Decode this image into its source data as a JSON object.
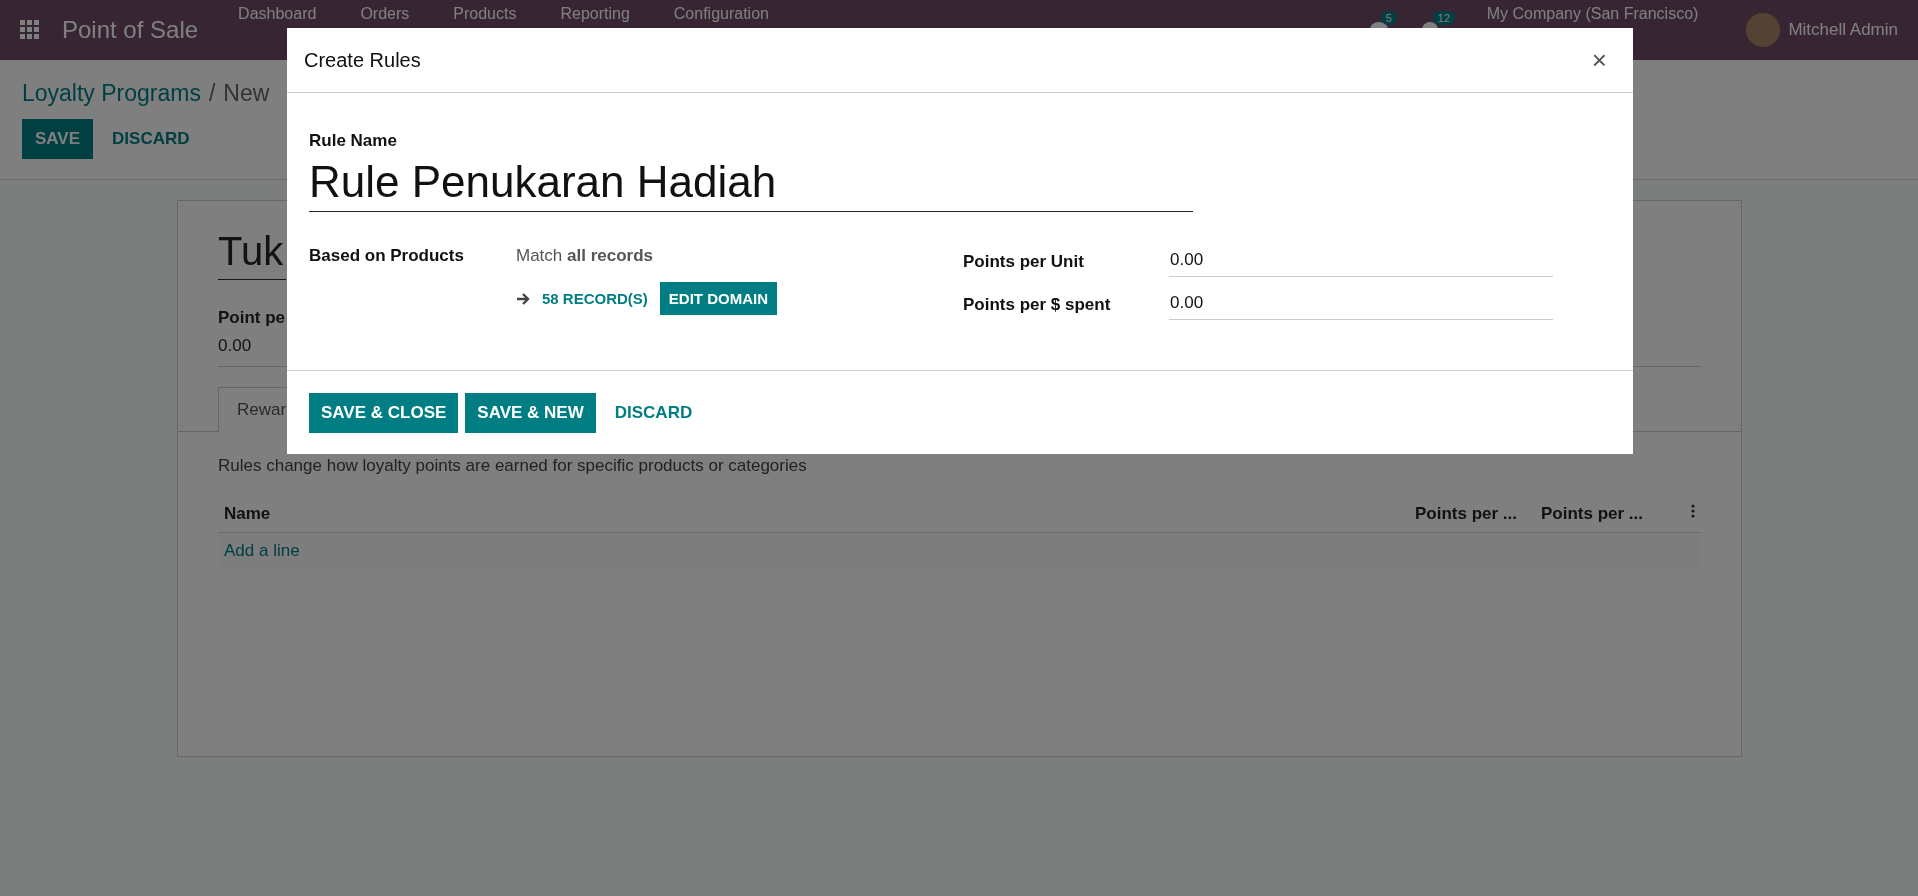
{
  "navbar": {
    "app_name": "Point of Sale",
    "menu": [
      "Dashboard",
      "Orders",
      "Products",
      "Reporting",
      "Configuration"
    ],
    "messages_count": "5",
    "activities_count": "12",
    "company": "My Company (San Francisco)",
    "user": "Mitchell Admin"
  },
  "breadcrumb": {
    "parent": "Loyalty Programs",
    "separator": "/",
    "current": "New"
  },
  "form_buttons": [
    {
      "label": "SAVE",
      "kind": "primary"
    },
    {
      "label": "DISCARD",
      "kind": "link"
    }
  ],
  "program": {
    "name": "Tuk",
    "field_label": "Point pe",
    "field_value": "0.00",
    "tabs": [
      {
        "label": "Rewar",
        "selected": true
      }
    ],
    "description": "Rules change how loyalty points are earned for specific products or categories",
    "table": {
      "columns": [
        "Name",
        "Points per ...",
        "Points per ..."
      ],
      "add_line": "Add a line"
    }
  },
  "dialog": {
    "title": "Create Rules",
    "close": "×",
    "rule_name_label": "Rule Name",
    "rule_name": "Rule Penukaran Hadiah",
    "based_on_label": "Based on Products",
    "domain_text": "Match **all records**",
    "records": "58 RECORD(S)",
    "edit_domain": "EDIT DOMAIN",
    "fields": [
      {
        "label": "Points per Unit",
        "value": "0.00"
      },
      {
        "label": "Points per $ spent",
        "value": "0.00"
      }
    ],
    "buttons": [
      {
        "label": "SAVE & CLOSE",
        "kind": "primary"
      },
      {
        "label": "SAVE & NEW",
        "kind": "primary"
      },
      {
        "label": "DISCARD",
        "kind": "link"
      }
    ]
  }
}
